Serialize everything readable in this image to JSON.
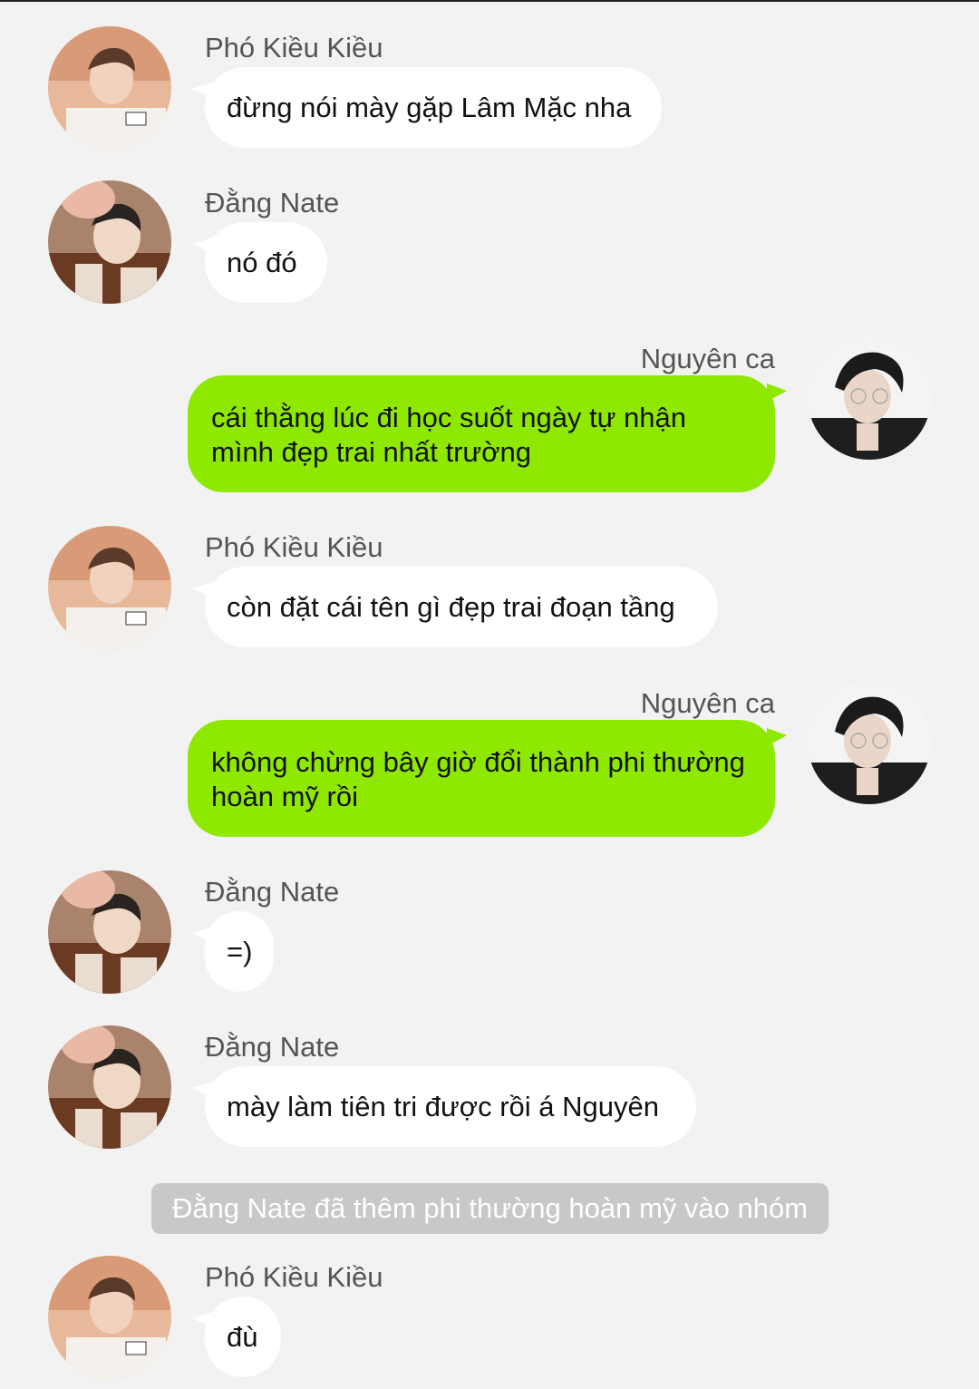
{
  "messages": [
    {
      "sender": "Phó Kiều Kiều",
      "text": "đừng nói mày gặp Lâm Mặc nha",
      "side": "left",
      "avatar": "pho-kieu-kieu-avatar"
    },
    {
      "sender": "Đằng Nate",
      "text": "nó đó",
      "side": "left",
      "avatar": "dang-nate-avatar"
    },
    {
      "sender": "Nguyên ca",
      "text": "cái thằng lúc đi học suốt ngày tự nhận mình đẹp trai nhất trường",
      "side": "right",
      "avatar": "nguyen-ca-avatar"
    },
    {
      "sender": "Phó Kiều Kiều",
      "text": "còn đặt cái tên gì đẹp trai đoạn tầng",
      "side": "left",
      "avatar": "pho-kieu-kieu-avatar"
    },
    {
      "sender": "Nguyên ca",
      "text": "không chừng bây giờ đổi thành phi thường hoàn mỹ rồi",
      "side": "right",
      "avatar": "nguyen-ca-avatar"
    },
    {
      "sender": "Đằng Nate",
      "text": "=)",
      "side": "left",
      "avatar": "dang-nate-avatar"
    },
    {
      "sender": "Đằng Nate",
      "text": "mày làm tiên tri được rồi á Nguyên",
      "side": "left",
      "avatar": "dang-nate-avatar"
    },
    {
      "sender": "Phó Kiều Kiều",
      "text": "đù",
      "side": "left",
      "avatar": "pho-kieu-kieu-avatar"
    }
  ],
  "system_notice": "Đằng Nate đã thêm phi thường hoàn mỹ vào nhóm",
  "colors": {
    "background": "#f2f2f2",
    "incoming_bubble": "#ffffff",
    "outgoing_bubble": "#8fe800",
    "system_notice_bg": "#c8c8c8"
  }
}
